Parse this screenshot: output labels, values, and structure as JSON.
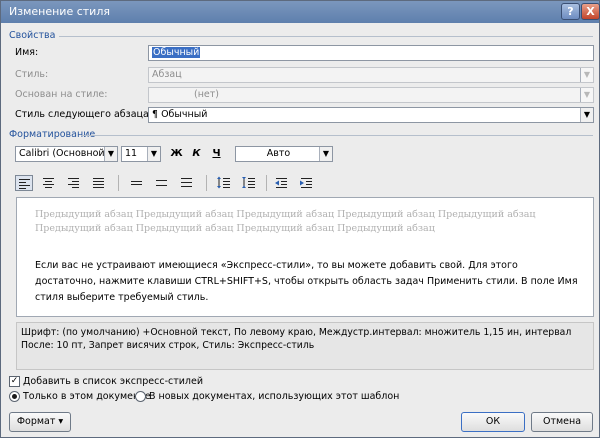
{
  "title": "Изменение стиля",
  "titlebar": {
    "help": "?",
    "close": "X"
  },
  "props": {
    "section": "Свойства",
    "name_label": "Имя:",
    "name_value": "Обычный",
    "style_label": "Стиль:",
    "style_value": "Абзац",
    "based_label": "Основан на стиле:",
    "based_value": "(нет)",
    "next_label": "Стиль следующего абзаца:",
    "next_value": "¶ Обычный"
  },
  "format": {
    "section": "Форматирование",
    "font": "Calibri (Основной текс",
    "size": "11",
    "bold": "Ж",
    "italic": "К",
    "underline": "Ч",
    "color": "Авто"
  },
  "preview": {
    "prev_text": "Предыдущий абзац Предыдущий абзац Предыдущий абзац Предыдущий абзац Предыдущий абзац Предыдущий абзац Предыдущий абзац Предыдущий абзац Предыдущий абзац",
    "sample_text": "Если вас не устраивают имеющиеся «Экспресс-стили», то вы можете добавить свой. Для этого достаточно, нажмите клавиши CTRL+SHIFT+S, чтобы открыть область задач Применить стили. В поле Имя стиля выберите требуемый стиль."
  },
  "description": "Шрифт: (по умолчанию) +Основной текст, По левому краю, Междустр.интервал:  множитель 1,15 ин, интервал После:  10 пт, Запрет висячих строк, Стиль: Экспресс-стиль",
  "options": {
    "add_quick": "Добавить в список экспресс-стилей",
    "add_quick_checked": true,
    "only_doc": "Только в этом документе",
    "new_docs": "В новых документах, использующих этот шаблон"
  },
  "buttons": {
    "format": "Формат ▾",
    "ok": "ОК",
    "cancel": "Отмена"
  }
}
